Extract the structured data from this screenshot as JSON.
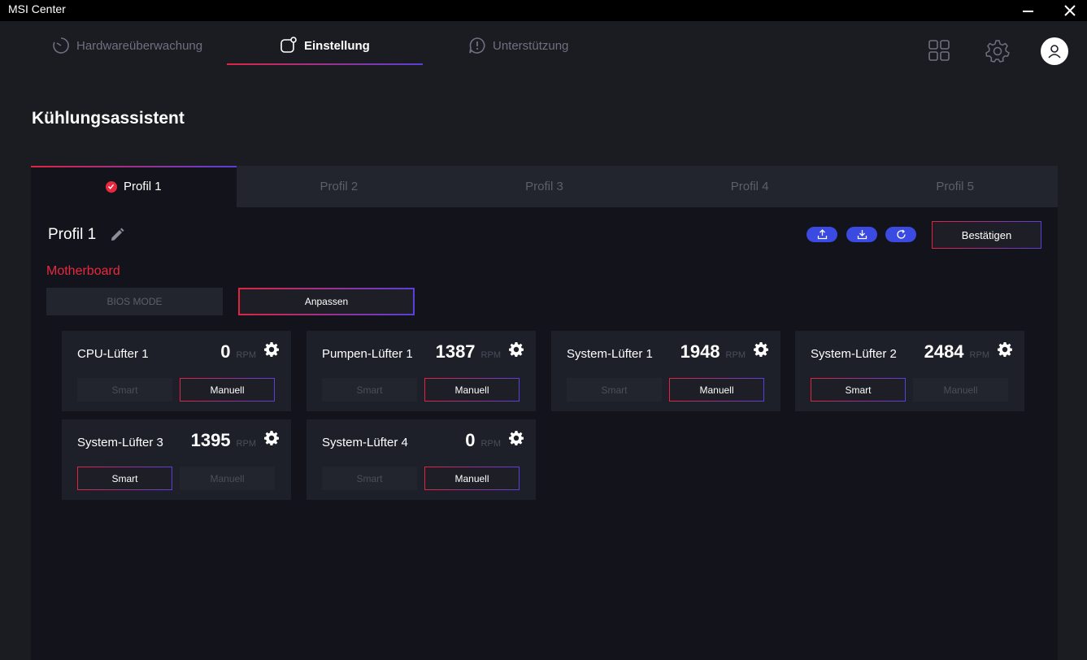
{
  "titlebar": {
    "title": "MSI Center"
  },
  "nav": {
    "tabs": [
      {
        "label": "Hardwareüberwachung",
        "icon": "gauge-icon"
      },
      {
        "label": "Einstellung",
        "icon": "settings-tile-icon"
      },
      {
        "label": "Unterstützung",
        "icon": "support-bubble-icon"
      }
    ],
    "active_tab": "Einstellung"
  },
  "page": {
    "title": "Kühlungsassistent"
  },
  "profiles": {
    "tabs": [
      "Profil 1",
      "Profil 2",
      "Profil 3",
      "Profil 4",
      "Profil 5"
    ],
    "active": "Profil 1"
  },
  "profile": {
    "name": "Profil 1",
    "confirm_label": "Bestätigen",
    "section": "Motherboard",
    "bios_mode_label": "BIOS MODE",
    "custom_label": "Anpassen"
  },
  "fans": [
    {
      "name": "CPU-Lüfter 1",
      "rpm": "0",
      "unit": "RPM",
      "smart_label": "Smart",
      "manual_label": "Manuell",
      "mode": "manual"
    },
    {
      "name": "Pumpen-Lüfter 1",
      "rpm": "1387",
      "unit": "RPM",
      "smart_label": "Smart",
      "manual_label": "Manuell",
      "mode": "manual"
    },
    {
      "name": "System-Lüfter 1",
      "rpm": "1948",
      "unit": "RPM",
      "smart_label": "Smart",
      "manual_label": "Manuell",
      "mode": "manual"
    },
    {
      "name": "System-Lüfter 2",
      "rpm": "2484",
      "unit": "RPM",
      "smart_label": "Smart",
      "manual_label": "Manuell",
      "mode": "smart"
    },
    {
      "name": "System-Lüfter 3",
      "rpm": "1395",
      "unit": "RPM",
      "smart_label": "Smart",
      "manual_label": "Manuell",
      "mode": "smart"
    },
    {
      "name": "System-Lüfter 4",
      "rpm": "0",
      "unit": "RPM",
      "smart_label": "Smart",
      "manual_label": "Manuell",
      "mode": "manual"
    }
  ],
  "colors": {
    "background": "#1b1c22",
    "panel": "#13141b",
    "card": "#1d1f29",
    "accent_red": "#e02440",
    "accent_purple": "#5a3fd8",
    "action_blue": "#3b4ae0"
  }
}
